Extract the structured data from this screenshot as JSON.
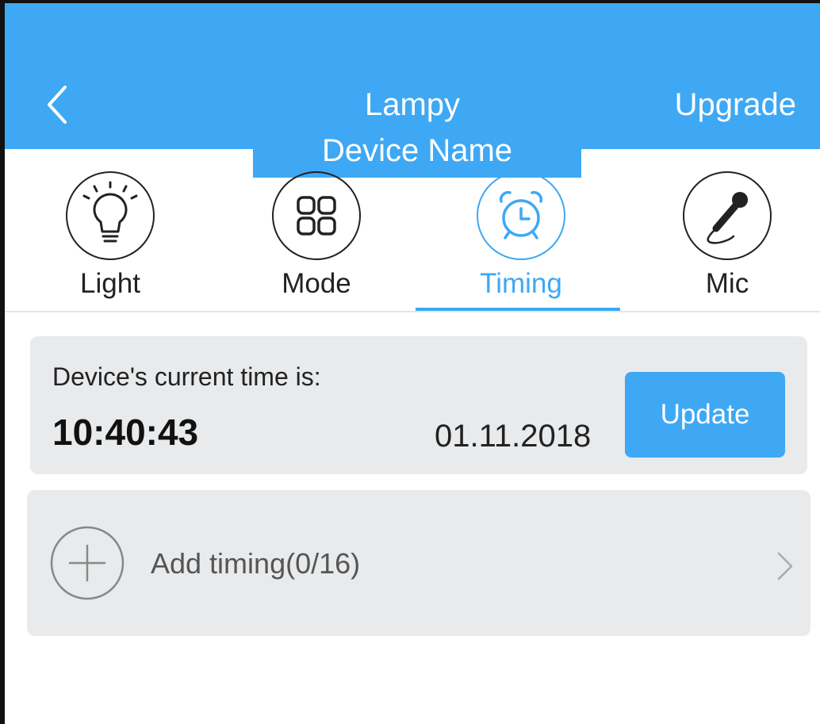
{
  "header": {
    "title": "Lampy",
    "action_label": "Upgrade",
    "device_name_overlay": "Device Name",
    "back_icon": "chevron-left-icon"
  },
  "tabs": [
    {
      "label": "Light",
      "icon": "light-bulb-icon",
      "active": false
    },
    {
      "label": "Mode",
      "icon": "grid-icon",
      "active": false
    },
    {
      "label": "Timing",
      "icon": "alarm-clock-icon",
      "active": true
    },
    {
      "label": "Mic",
      "icon": "microphone-icon",
      "active": false
    }
  ],
  "time_card": {
    "caption": "Device's current time is:",
    "time": "10:40:43",
    "date": "01.11.2018",
    "update_label": "Update"
  },
  "add_timing": {
    "label": "Add timing(0/16)",
    "icon": "plus-circle-icon",
    "chevron_icon": "chevron-right-icon"
  },
  "colors": {
    "accent": "#3ea8f4",
    "card_background": "#e8eaec",
    "text_dark": "#222222",
    "text_muted": "#555555"
  }
}
